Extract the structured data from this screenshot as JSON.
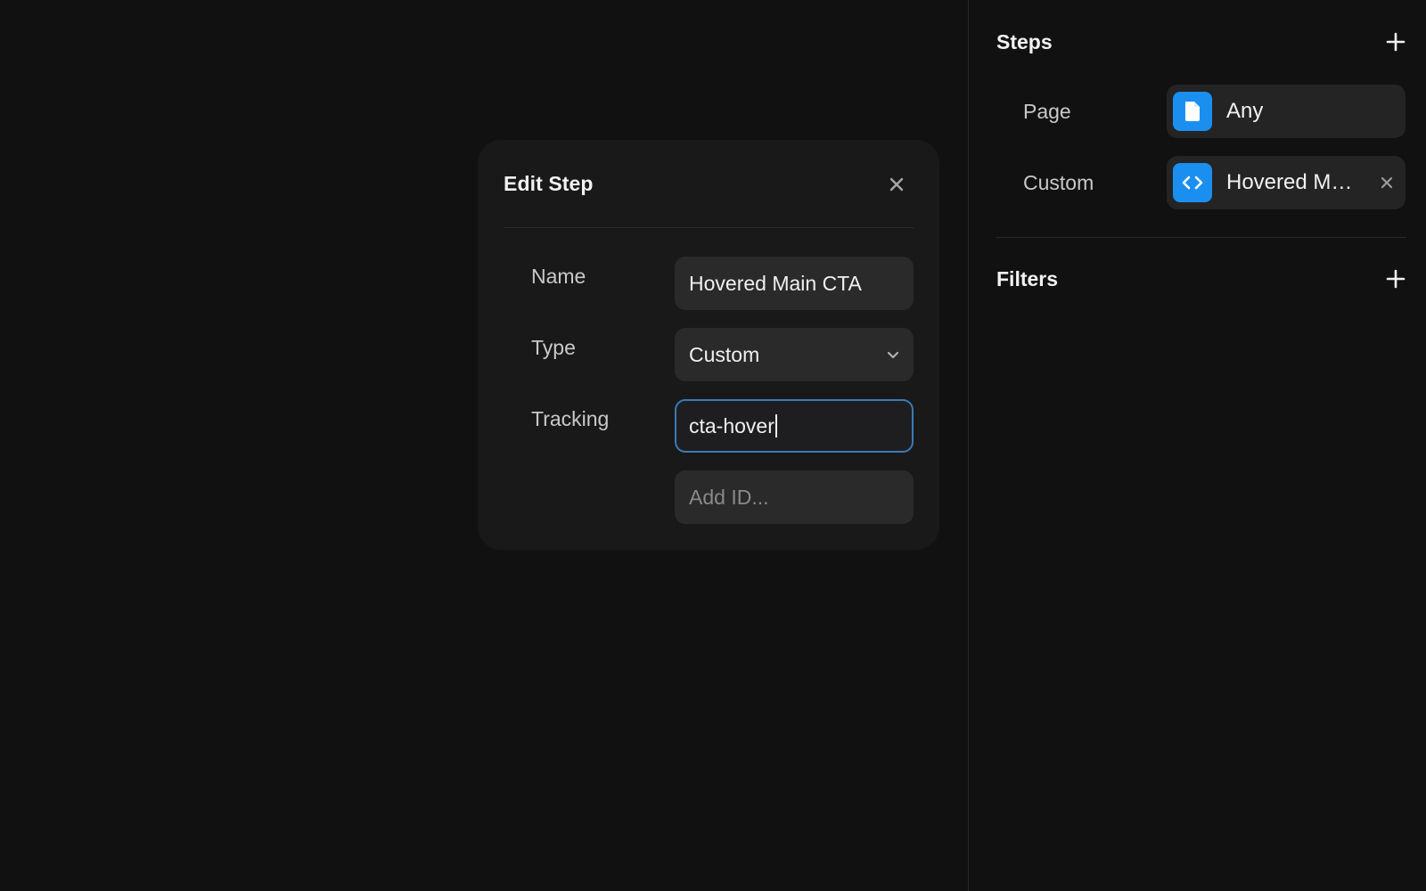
{
  "modal": {
    "title": "Edit Step",
    "fields": {
      "name": {
        "label": "Name",
        "value": "Hovered Main CTA"
      },
      "type": {
        "label": "Type",
        "value": "Custom"
      },
      "tracking": {
        "label": "Tracking",
        "value": "cta-hover"
      },
      "add_id": {
        "placeholder": "Add ID..."
      }
    }
  },
  "panel": {
    "steps_title": "Steps",
    "steps": [
      {
        "label": "Page",
        "value": "Any",
        "icon": "file-icon"
      },
      {
        "label": "Custom",
        "value": "Hovered Main CTA",
        "icon": "code-icon"
      }
    ],
    "filters_title": "Filters"
  },
  "colors": {
    "background": "#111112",
    "modal": "#191919",
    "field": "#2a2a2a",
    "accent_blue": "#1b8ff0",
    "focus_border": "#3a7ab8"
  }
}
